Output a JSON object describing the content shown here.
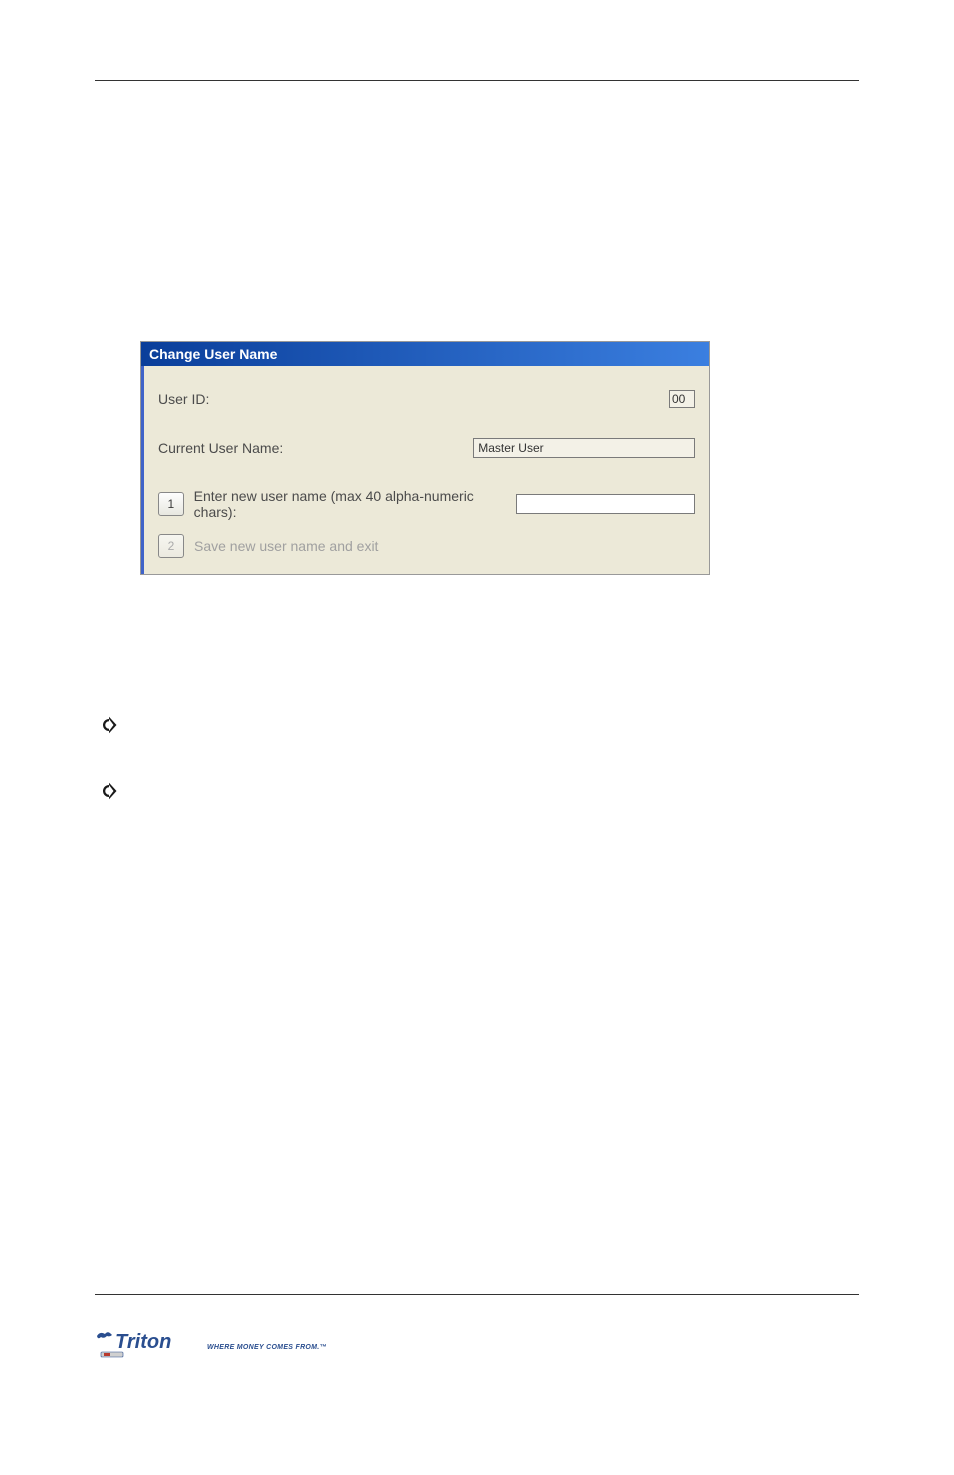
{
  "dialog": {
    "title": "Change User Name",
    "user_id_label": "User ID:",
    "user_id_value": "00",
    "current_label": "Current User Name:",
    "current_value": "Master User",
    "option1_num": "1",
    "option1_label": "Enter new user name (max 40 alpha-numeric chars):",
    "option2_num": "2",
    "option2_label": "Save new user name and exit"
  },
  "logo": {
    "brand": "Triton",
    "tagline": "WHERE MONEY COMES FROM.™"
  }
}
